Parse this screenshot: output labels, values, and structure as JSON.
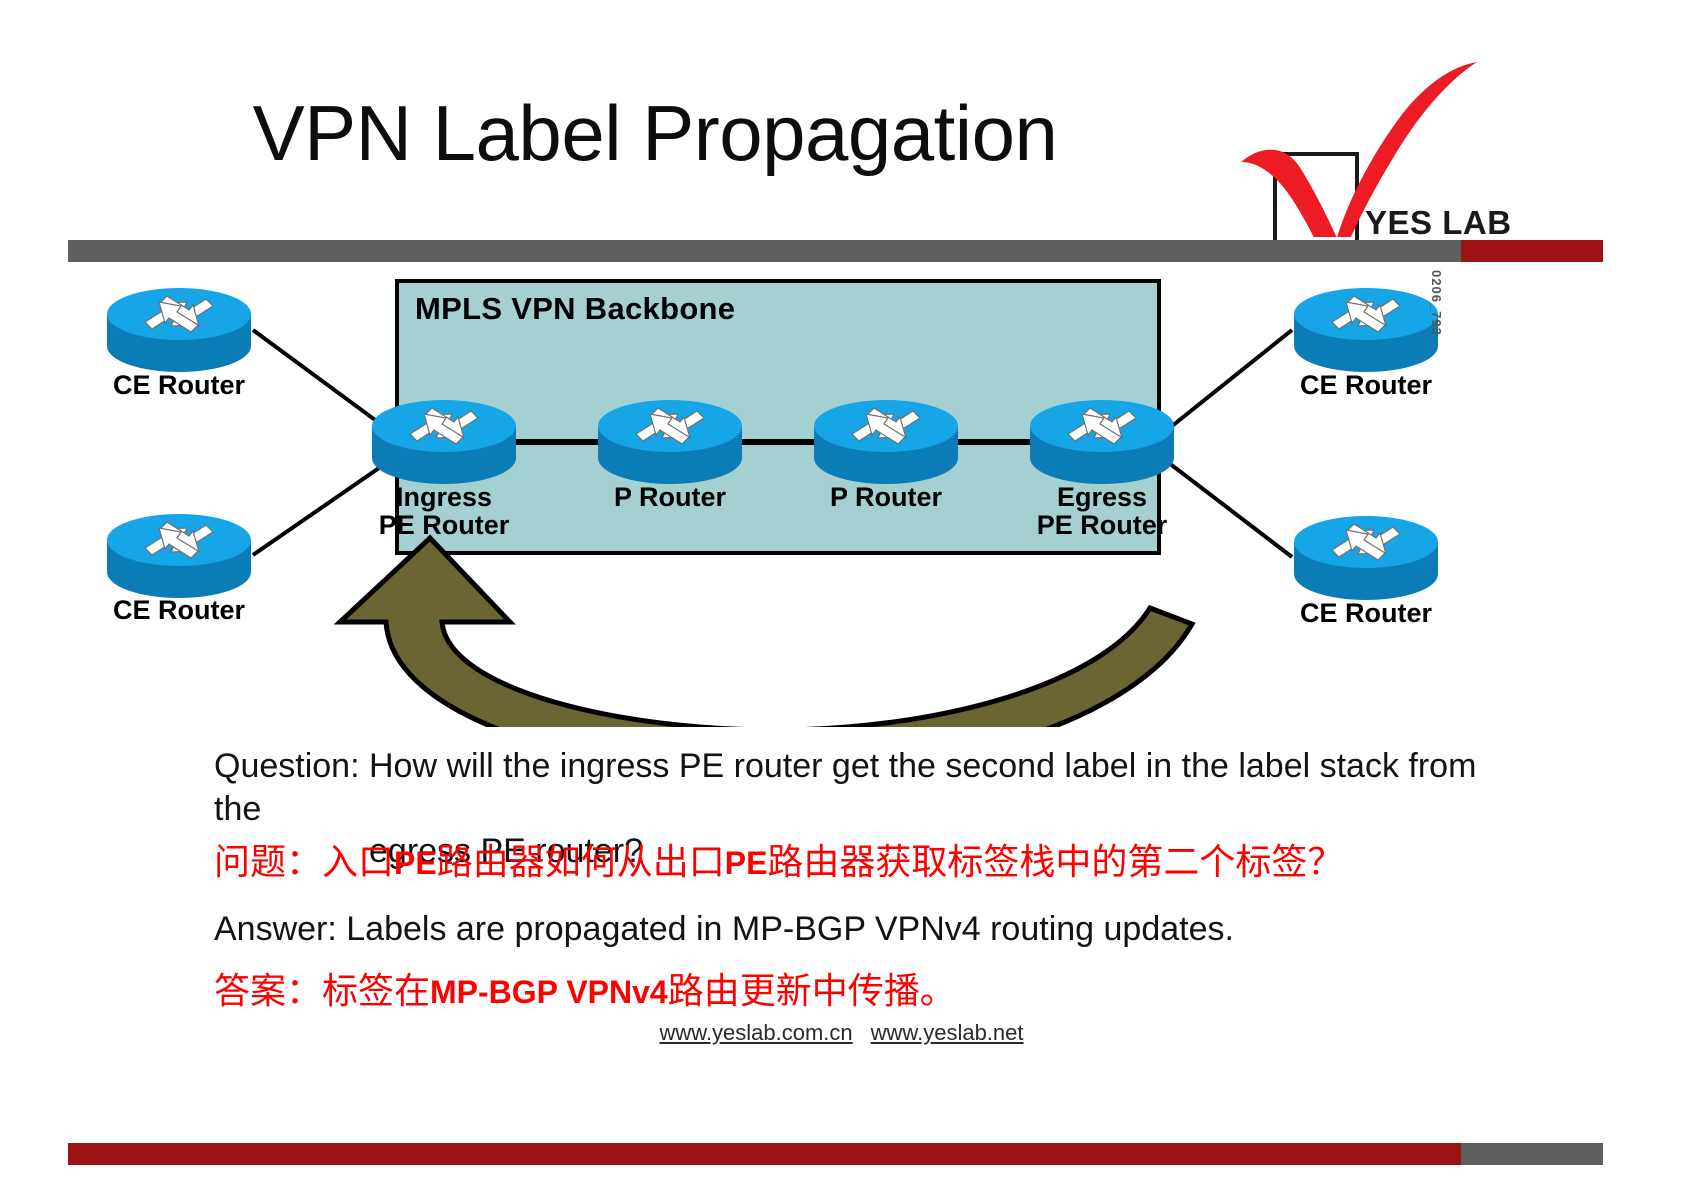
{
  "slide": {
    "title": "VPN Label Propagation",
    "brand": {
      "name": "YES LAB",
      "check_icon": "check-mark-icon",
      "accent_red": "#ed1c24"
    },
    "rules": {
      "header_grey": "#5f5f5f",
      "header_red": "#9c1111",
      "footer_red": "#9c1111",
      "footer_grey": "#5f5f5f"
    }
  },
  "diagram": {
    "backbone_label": "MPLS VPN Backbone",
    "backbone_fill": "#a4d0d2",
    "arrow_fill": "#6b6534",
    "router_icon": "cisco-router-icon",
    "source_code": "0206_793",
    "customer_routers": [
      {
        "label": "CE Router",
        "position": "top-left"
      },
      {
        "label": "CE Router",
        "position": "bottom-left"
      },
      {
        "label": "CE Router",
        "position": "top-right"
      },
      {
        "label": "CE Router",
        "position": "bottom-right"
      }
    ],
    "backbone_routers": [
      {
        "line1": "Ingress",
        "line2": "PE Router"
      },
      {
        "line1": "P Router",
        "line2": ""
      },
      {
        "line1": "P Router",
        "line2": ""
      },
      {
        "line1": "Egress",
        "line2": "PE Router"
      }
    ]
  },
  "content": {
    "question_en_line1": "Question: How will the ingress PE router get the second label in the  label  stack from the",
    "question_en_line2": "egress  PE router?",
    "question_cn_pre": "问题：入口",
    "question_cn_lat1": "PE",
    "question_cn_mid": "路由器如何从出口",
    "question_cn_lat2": "PE",
    "question_cn_post": "路由器获取标签栈中的第二个标签？",
    "answer_en": "Answer: Labels are propagated in MP-BGP  VPNv4 routing updates.",
    "answer_cn_pre": "答案：标签在",
    "answer_cn_lat": "MP-BGP  VPNv4",
    "answer_cn_post": "路由更新中传播。"
  },
  "footer": {
    "link1": "www.yeslab.com.cn",
    "link2": "www.yeslab.net"
  }
}
